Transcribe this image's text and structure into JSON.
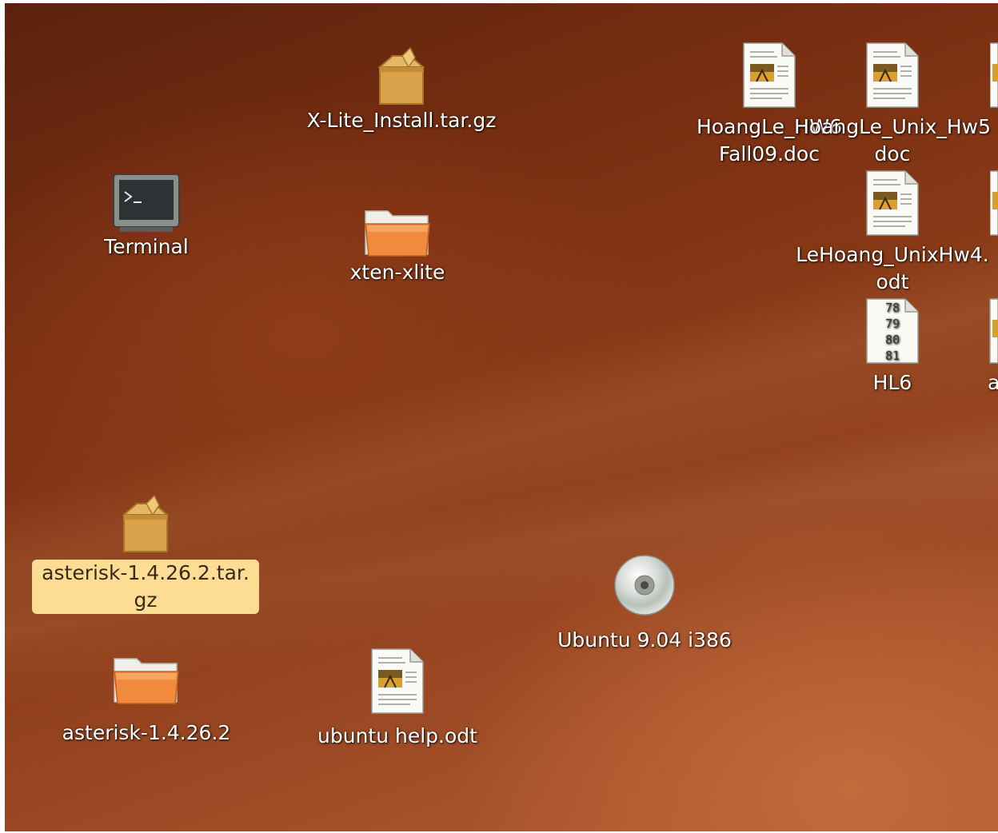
{
  "desktop": {
    "icons": [
      {
        "id": "x-lite-install",
        "label": "X-Lite_Install.tar.gz",
        "icon": "package-archive-icon"
      },
      {
        "id": "terminal",
        "label": "Terminal",
        "icon": "terminal-icon"
      },
      {
        "id": "xten-xlite",
        "label": "xten-xlite",
        "icon": "folder-icon"
      },
      {
        "id": "asterisk-archive",
        "label": "asterisk-1.4.26.2.tar.gz",
        "label_line1": "asterisk-1.4.26.2.tar.",
        "label_line2": "gz",
        "icon": "package-archive-icon",
        "selected": true
      },
      {
        "id": "asterisk-folder",
        "label": "asterisk-1.4.26.2",
        "icon": "folder-icon"
      },
      {
        "id": "ubuntu-help",
        "label": "ubuntu help.odt",
        "icon": "document-icon"
      },
      {
        "id": "ubuntu-cd",
        "label": "Ubuntu 9.04 i386",
        "icon": "cd-drive-icon"
      },
      {
        "id": "hoangle-fall09",
        "label_line1": "HoangLe_HW6",
        "label_line2": "Fall09.doc",
        "icon": "document-icon"
      },
      {
        "id": "hoangle-unix-hw5",
        "label_line1": "HoangLe_Unix_Hw5",
        "label_line2": "doc",
        "icon": "document-icon"
      },
      {
        "id": "lehoang-unixhw4",
        "label_line1": "LeHoang_UnixHw4.",
        "label_line2": "odt",
        "icon": "document-icon"
      },
      {
        "id": "hl6",
        "label": "HL6",
        "icon": "text-file-icon",
        "preview_lines": [
          "78",
          "79",
          "80",
          "81"
        ]
      },
      {
        "id": "partial-a",
        "label": "a",
        "icon": "document-icon"
      }
    ]
  },
  "colors": {
    "selection_bg": "#fddc94",
    "label_text": "#ffffff"
  }
}
